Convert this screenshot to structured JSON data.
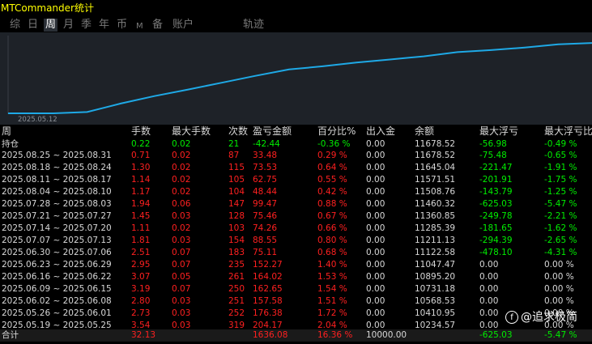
{
  "window": {
    "title": "MTCommander统计"
  },
  "tabs": [
    {
      "label": "综",
      "active": false
    },
    {
      "label": "日",
      "active": false
    },
    {
      "label": "周",
      "active": true
    },
    {
      "label": "月",
      "active": false
    },
    {
      "label": "季",
      "active": false
    },
    {
      "label": "年",
      "active": false
    },
    {
      "label": "币",
      "active": false
    },
    {
      "label": "M",
      "active": false
    },
    {
      "label": "备",
      "active": false
    },
    {
      "label": "账户",
      "active": false
    },
    {
      "label": "轨迹",
      "active": false
    }
  ],
  "chart": {
    "start_label": "2025.05.12",
    "line_color": "#1ea9e6"
  },
  "chart_data": {
    "type": "line",
    "series": [
      {
        "values": [
          10000.0,
          10030.4,
          10234.57,
          10410.95,
          10568.53,
          10731.18,
          10895.2,
          11047.47,
          11122.58,
          11211.13,
          11285.39,
          11360.85,
          11460.32,
          11508.76,
          11571.51,
          11645.04,
          11678.52
        ]
      }
    ],
    "x": [
      "2025.05.12",
      "2025.05.19",
      "2025.05.26",
      "2025.06.02",
      "2025.06.09",
      "2025.06.16",
      "2025.06.23",
      "2025.06.30",
      "2025.07.07",
      "2025.07.14",
      "2025.07.21",
      "2025.07.28",
      "2025.08.04",
      "2025.08.11",
      "2025.08.18",
      "2025.08.25",
      "2025.08.31"
    ],
    "ylim": [
      10000,
      11700
    ]
  },
  "table": {
    "headers": [
      "周",
      "手数",
      "最大手数",
      "次数",
      "盈亏金额",
      "百分比%",
      "出入金",
      "余额",
      "最大浮亏",
      "最大浮亏比"
    ],
    "holding": [
      "持仓",
      "0.22",
      "0.02",
      "21",
      "-42.44",
      "-0.36 %",
      "0.00",
      "11678.52",
      "-56.98",
      "-0.49 %"
    ],
    "rows": [
      [
        "2025.08.25 ~ 2025.08.31",
        "0.71",
        "0.02",
        "87",
        "33.48",
        "0.29 %",
        "0.00",
        "11678.52",
        "-75.48",
        "-0.65 %"
      ],
      [
        "2025.08.18 ~ 2025.08.24",
        "1.30",
        "0.02",
        "115",
        "73.53",
        "0.64 %",
        "0.00",
        "11645.04",
        "-221.47",
        "-1.91 %"
      ],
      [
        "2025.08.11 ~ 2025.08.17",
        "1.14",
        "0.02",
        "105",
        "62.75",
        "0.55 %",
        "0.00",
        "11571.51",
        "-201.91",
        "-1.75 %"
      ],
      [
        "2025.08.04 ~ 2025.08.10",
        "1.17",
        "0.02",
        "104",
        "48.44",
        "0.42 %",
        "0.00",
        "11508.76",
        "-143.79",
        "-1.25 %"
      ],
      [
        "2025.07.28 ~ 2025.08.03",
        "1.94",
        "0.06",
        "147",
        "99.47",
        "0.88 %",
        "0.00",
        "11460.32",
        "-625.03",
        "-5.47 %"
      ],
      [
        "2025.07.21 ~ 2025.07.27",
        "1.45",
        "0.03",
        "128",
        "75.46",
        "0.67 %",
        "0.00",
        "11360.85",
        "-249.78",
        "-2.21 %"
      ],
      [
        "2025.07.14 ~ 2025.07.20",
        "1.11",
        "0.02",
        "103",
        "74.26",
        "0.66 %",
        "0.00",
        "11285.39",
        "-181.65",
        "-1.62 %"
      ],
      [
        "2025.07.07 ~ 2025.07.13",
        "1.81",
        "0.03",
        "154",
        "88.55",
        "0.80 %",
        "0.00",
        "11211.13",
        "-294.39",
        "-2.65 %"
      ],
      [
        "2025.06.30 ~ 2025.07.06",
        "2.51",
        "0.07",
        "183",
        "75.11",
        "0.68 %",
        "0.00",
        "11122.58",
        "-478.10",
        "-4.31 %"
      ],
      [
        "2025.06.23 ~ 2025.06.29",
        "2.95",
        "0.07",
        "235",
        "152.27",
        "1.40 %",
        "0.00",
        "11047.47",
        "0.00",
        "0.00 %"
      ],
      [
        "2025.06.16 ~ 2025.06.22",
        "3.07",
        "0.05",
        "261",
        "164.02",
        "1.53 %",
        "0.00",
        "10895.20",
        "0.00",
        "0.00 %"
      ],
      [
        "2025.06.09 ~ 2025.06.15",
        "3.19",
        "0.07",
        "250",
        "162.65",
        "1.54 %",
        "0.00",
        "10731.18",
        "0.00",
        "0.00 %"
      ],
      [
        "2025.06.02 ~ 2025.06.08",
        "2.80",
        "0.03",
        "251",
        "157.58",
        "1.51 %",
        "0.00",
        "10568.53",
        "0.00",
        "0.00 %"
      ],
      [
        "2025.05.26 ~ 2025.06.01",
        "2.73",
        "0.03",
        "252",
        "176.38",
        "1.72 %",
        "0.00",
        "10410.95",
        "0.00",
        "0.00 %"
      ],
      [
        "2025.05.19 ~ 2025.05.25",
        "3.54",
        "0.03",
        "319",
        "204.17",
        "2.04 %",
        "0.00",
        "10234.57",
        "0.00",
        "0.00 %"
      ],
      [
        "2025.05.12 ~ 2025.05.18",
        "0.49",
        "0.01",
        "49",
        "30.40",
        "0.30 %",
        "10000.00",
        "10030.40",
        "-101.42",
        "-1.01 %"
      ]
    ],
    "total": [
      "合计",
      "32.13",
      "",
      "",
      "1636.08",
      "16.36 %",
      "10000.00",
      "",
      "-625.03",
      "-5.47 %"
    ]
  },
  "watermark": {
    "icon": "zhihu-logo-icon",
    "logo_text": "f",
    "text": "@追求极简"
  }
}
